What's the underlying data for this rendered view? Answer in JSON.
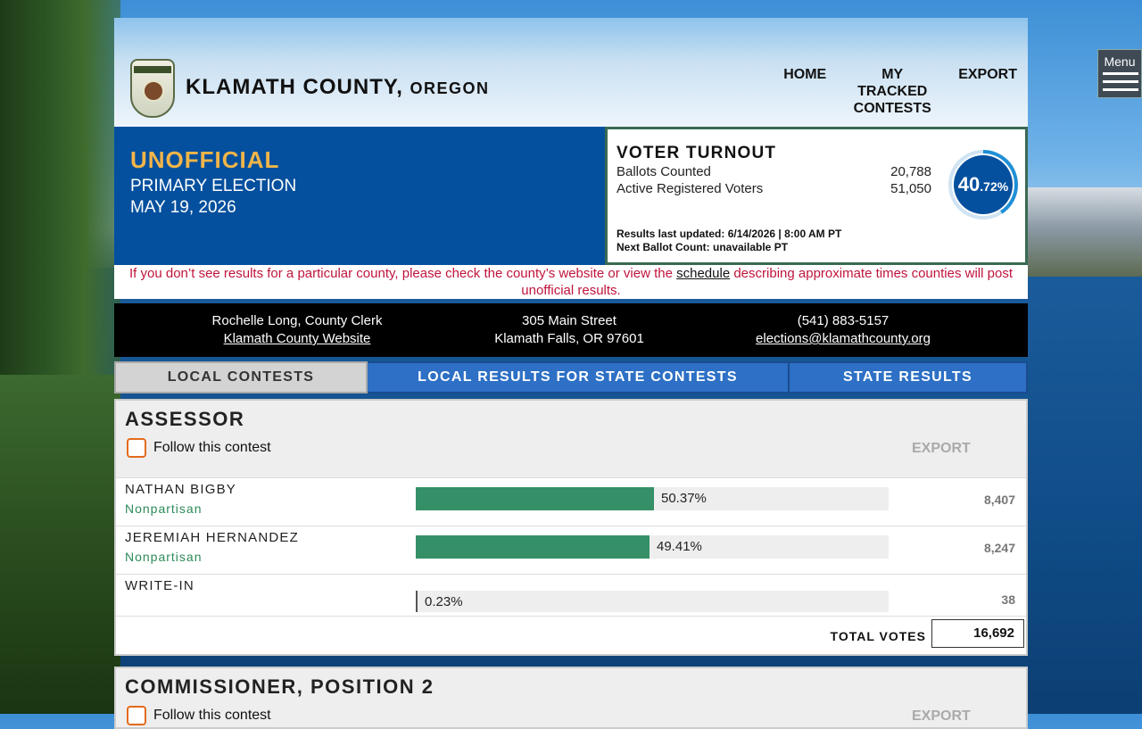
{
  "site": {
    "county": "KLAMATH COUNTY,",
    "state": "OREGON",
    "menu_label": "Menu"
  },
  "nav": {
    "home": "HOME",
    "tracked_line1": "MY TRACKED",
    "tracked_line2": "CONTESTS",
    "export": "EXPORT"
  },
  "election": {
    "status": "UNOFFICIAL",
    "name": "PRIMARY ELECTION",
    "date": "MAY 19, 2026"
  },
  "turnout": {
    "title": "VOTER TURNOUT",
    "ballots_label": "Ballots Counted",
    "ballots_value": "20,788",
    "registered_label": "Active Registered Voters",
    "registered_value": "51,050",
    "percent_whole": "40",
    "percent_decimal": ".72%",
    "percent_fraction": 0.4072,
    "last_updated": "Results last updated: 6/14/2026 | 8:00 AM PT",
    "next_count": "Next Ballot Count: unavailable PT"
  },
  "notice": {
    "before": "If you don’t see results for a particular county, please check the county’s website or view the ",
    "link": "schedule",
    "after": " describing approximate times counties will post unofficial results."
  },
  "clerk": {
    "name": "Rochelle Long, County Clerk",
    "website": "Klamath County Website",
    "address1": "305 Main Street",
    "address2": "Klamath Falls, OR 97601",
    "phone": "(541) 883-5157",
    "email": "elections@klamathcounty.org"
  },
  "tabs": {
    "local": "LOCAL CONTESTS",
    "local_state": "LOCAL RESULTS FOR STATE CONTESTS",
    "state": "STATE RESULTS"
  },
  "contest1": {
    "title": "ASSESSOR",
    "follow": "Follow this contest",
    "export": "EXPORT",
    "candidates": [
      {
        "name": "NATHAN BIGBY",
        "party": "Nonpartisan",
        "percent": "50.37%",
        "share": 0.5037,
        "votes": "8,407"
      },
      {
        "name": "JEREMIAH HERNANDEZ",
        "party": "Nonpartisan",
        "percent": "49.41%",
        "share": 0.4941,
        "votes": "8,247"
      },
      {
        "name": "WRITE-IN",
        "party": "",
        "percent": "0.23%",
        "share": 0.0023,
        "votes": "38"
      }
    ],
    "total_label": "TOTAL VOTES",
    "total_value": "16,692"
  },
  "contest2": {
    "title": "COMMISSIONER, POSITION 2",
    "follow": "Follow this contest",
    "export": "EXPORT"
  },
  "colors": {
    "election_blue": "#05509e",
    "status_gold": "#f2b548",
    "bar_green": "#359067",
    "party_green": "#2d8a5a",
    "notice_red": "#c0143c",
    "tab_blue": "#2d70c5"
  }
}
